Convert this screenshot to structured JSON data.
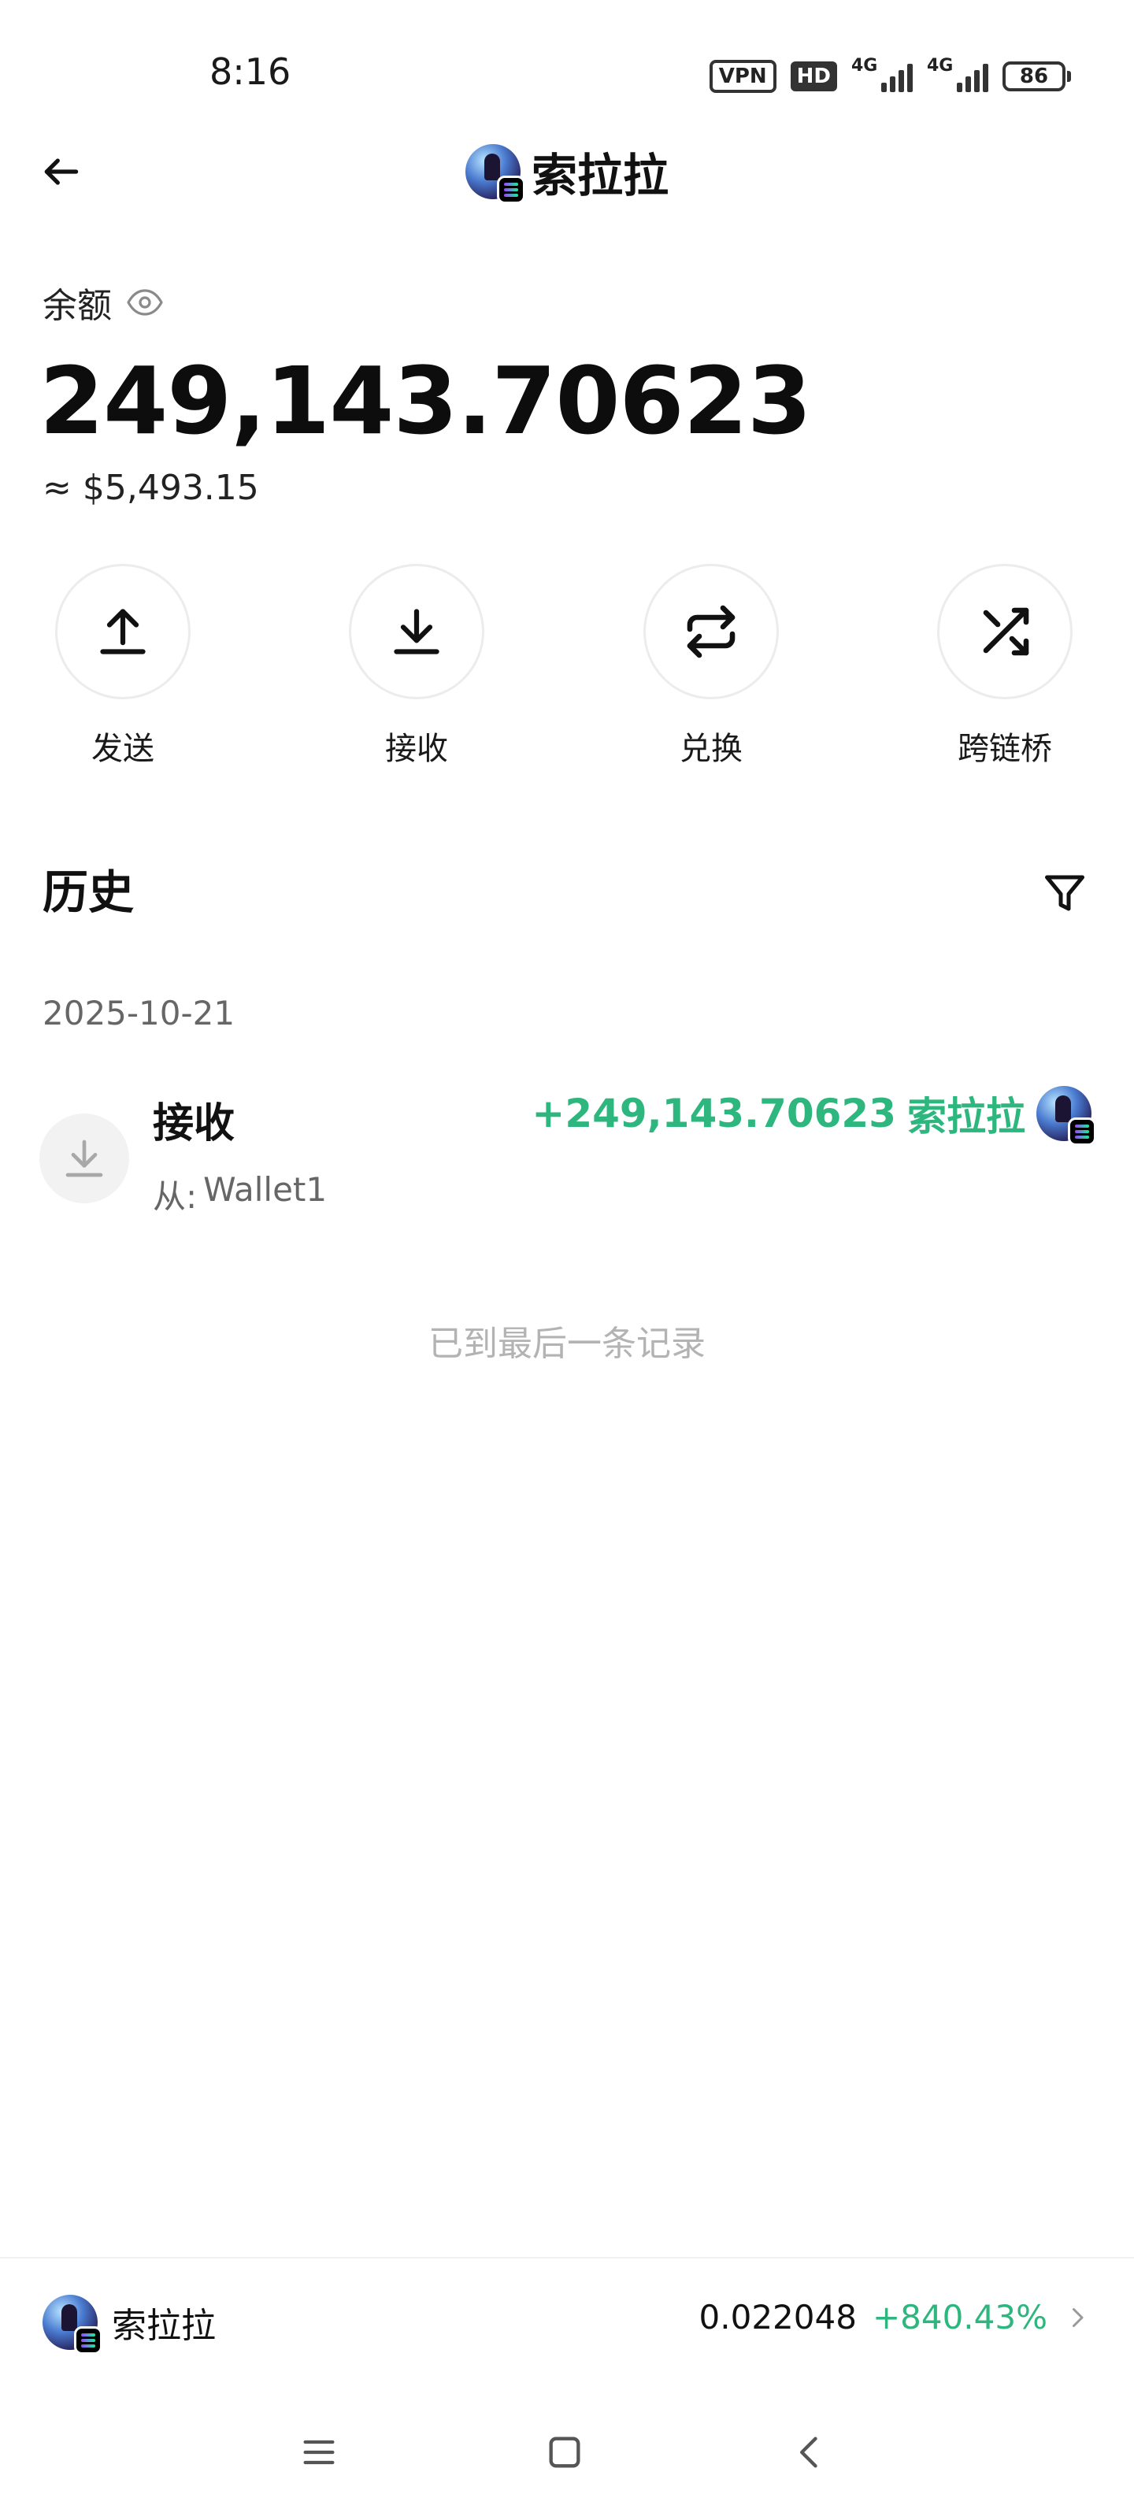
{
  "status_bar": {
    "time": "8:16",
    "vpn": "VPN",
    "hd": "HD",
    "network_1": "4G",
    "network_2": "4G",
    "battery": "86"
  },
  "header": {
    "title": "索拉拉"
  },
  "balance": {
    "label": "余额",
    "amount": "249,143.70623",
    "usd_value": "≈ $5,493.15"
  },
  "actions": [
    {
      "label": "发送",
      "icon": "upload-icon"
    },
    {
      "label": "接收",
      "icon": "download-icon"
    },
    {
      "label": "兑换",
      "icon": "repeat-icon"
    },
    {
      "label": "跨链桥",
      "icon": "shuffle-icon"
    }
  ],
  "history": {
    "title": "历史",
    "date": "2025-10-21",
    "transactions": [
      {
        "type": "接收",
        "from_label": "从:",
        "from_value": "Wallet1",
        "amount": "+249,143.70623",
        "symbol": "索拉拉"
      }
    ],
    "end_text": "已到最后一条记录"
  },
  "bottom_bar": {
    "token_name": "索拉拉",
    "price": "0.022048",
    "change": "+840.43%"
  },
  "colors": {
    "positive": "#2db67d",
    "text_primary": "#111111",
    "text_secondary": "#666666",
    "muted": "#b3b3b3"
  }
}
